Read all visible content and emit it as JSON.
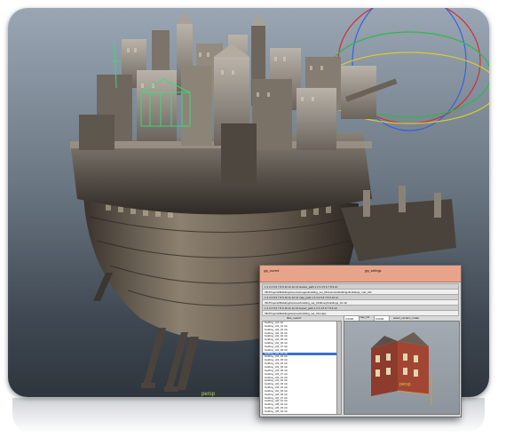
{
  "viewport": {
    "ground_label": "persp"
  },
  "tool_window": {
    "header": {
      "left_title": "grp_current",
      "right_title": "grp_settings",
      "left_button": "Add",
      "right_button": "Add"
    },
    "rows": [
      {
        "text": "1  2  3  4  5  6  7  8  9  10  11  12  13  texture_path  1  2  3  4  5  6  7  8  9  10"
      },
      {
        "text": "//B:/Projects/Buildings/sourceimages/building_set_01/textures/buildings/buildings_mat_v02"
      },
      {
        "text": "1  2  3  4  5  6  7  8  9  10  11  12  13  map_path  1  2  3  4  5  6  7  8  9  10  11"
      },
      {
        "text": "//B:/Projects/Buildings/scenes/building_set_01/library/buildings_01.mb"
      },
      {
        "text": "1  2  3  4  5  6  7  8  9  10  11  12  13  import_path  1  2  3  4  5  6  7  8  9  10"
      },
      {
        "text": "//B:/Projects/Buildings/scenes/building_set_01/maps"
      }
    ],
    "section_label": "map_list",
    "filter_label": "filter_search",
    "fields": {
      "value_a": "0.0000",
      "label_a": "select_random_rotate",
      "value_b": "0.0000",
      "label_b": "select_random_scale",
      "value_c": "1.0000",
      "value_d": "1.0000"
    },
    "list_items": [
      "building_v01.mb",
      "building_v02_01.mb",
      "building_v02_02.mb",
      "building_v02_03.mb",
      "building_v02_04.mb",
      "building_v02_05.mb",
      "building_v02_06.mb",
      "building_v02_07.mb",
      "building_v02_08.mb",
      "building_v03_01.mb",
      "building_v03_02.mb",
      "building_v03_03.mb",
      "building_v03_04.mb",
      "building_v03_05.mb",
      "building_v03_06.mb",
      "building_v03_07.mb",
      "building_v04_01.mb",
      "building_v04_02.mb",
      "building_v04_03.mb",
      "building_v04_04.mb",
      "building_v04_05.mb",
      "building_v04_06.mb",
      "building_v04_07.mb",
      "building_v05_01.mb",
      "building_v05_02.mb",
      "building_v05_03.mb",
      "building_v05_04.mb"
    ],
    "selected_index": 9,
    "preview_label": "persp"
  },
  "colors": {
    "viewport_top": "#9aa6b3",
    "viewport_bottom": "#2e353d",
    "tool_header": "#e8a48a",
    "selection": "#3b6fd1",
    "gizmo_red": "#d23030",
    "gizmo_green": "#2fb84a",
    "gizmo_blue": "#3860e0",
    "gizmo_yellow": "#d8cc32"
  }
}
